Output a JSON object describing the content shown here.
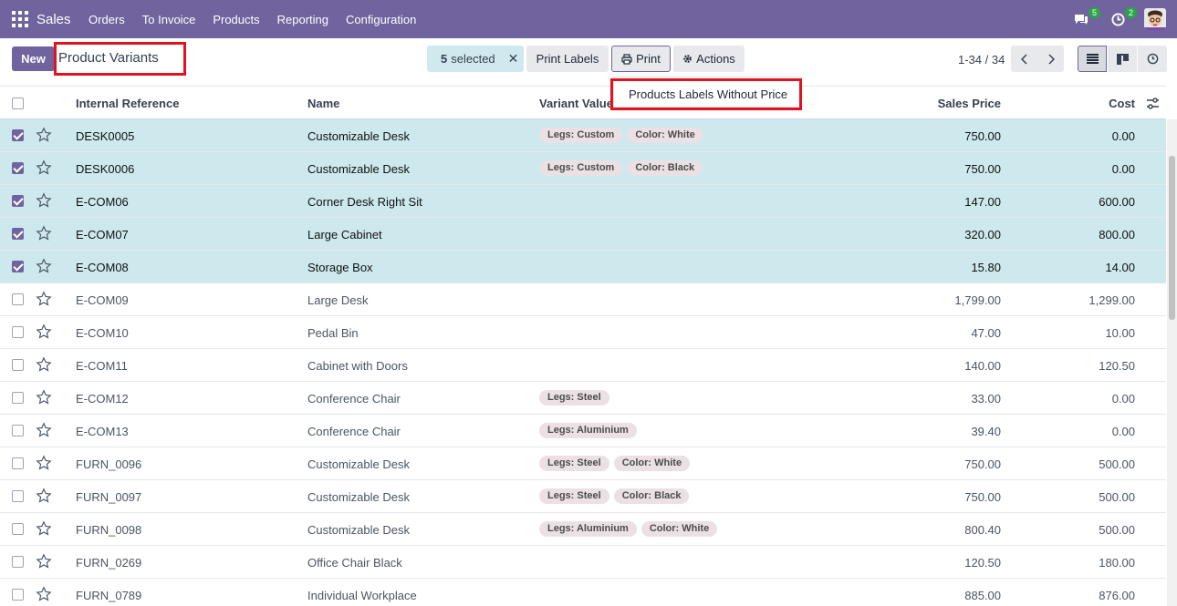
{
  "navbar": {
    "brand": "Sales",
    "menu": [
      "Orders",
      "To Invoice",
      "Products",
      "Reporting",
      "Configuration"
    ],
    "messages_count": "5",
    "activities_count": "2"
  },
  "control_panel": {
    "new_label": "New",
    "title": "Product Variants",
    "selected_count": "5",
    "selected_label": "selected",
    "print_labels": "Print Labels",
    "print": "Print",
    "actions": "Actions",
    "pager": "1-34 / 34"
  },
  "dropdown": {
    "item": "Products Labels Without Price"
  },
  "table": {
    "headers": {
      "ref": "Internal Reference",
      "name": "Name",
      "variant": "Variant Values",
      "price": "Sales Price",
      "cost": "Cost"
    },
    "rows": [
      {
        "selected": true,
        "ref": "DESK0005",
        "name": "Customizable Desk",
        "tags": [
          "Legs: Custom",
          "Color: White"
        ],
        "price": "750.00",
        "cost": "0.00"
      },
      {
        "selected": true,
        "ref": "DESK0006",
        "name": "Customizable Desk",
        "tags": [
          "Legs: Custom",
          "Color: Black"
        ],
        "price": "750.00",
        "cost": "0.00"
      },
      {
        "selected": true,
        "ref": "E-COM06",
        "name": "Corner Desk Right Sit",
        "tags": [],
        "price": "147.00",
        "cost": "600.00"
      },
      {
        "selected": true,
        "ref": "E-COM07",
        "name": "Large Cabinet",
        "tags": [],
        "price": "320.00",
        "cost": "800.00"
      },
      {
        "selected": true,
        "ref": "E-COM08",
        "name": "Storage Box",
        "tags": [],
        "price": "15.80",
        "cost": "14.00"
      },
      {
        "selected": false,
        "ref": "E-COM09",
        "name": "Large Desk",
        "tags": [],
        "price": "1,799.00",
        "cost": "1,299.00"
      },
      {
        "selected": false,
        "ref": "E-COM10",
        "name": "Pedal Bin",
        "tags": [],
        "price": "47.00",
        "cost": "10.00"
      },
      {
        "selected": false,
        "ref": "E-COM11",
        "name": "Cabinet with Doors",
        "tags": [],
        "price": "140.00",
        "cost": "120.50"
      },
      {
        "selected": false,
        "ref": "E-COM12",
        "name": "Conference Chair",
        "tags": [
          "Legs: Steel"
        ],
        "price": "33.00",
        "cost": "0.00"
      },
      {
        "selected": false,
        "ref": "E-COM13",
        "name": "Conference Chair",
        "tags": [
          "Legs: Aluminium"
        ],
        "price": "39.40",
        "cost": "0.00"
      },
      {
        "selected": false,
        "ref": "FURN_0096",
        "name": "Customizable Desk",
        "tags": [
          "Legs: Steel",
          "Color: White"
        ],
        "price": "750.00",
        "cost": "500.00"
      },
      {
        "selected": false,
        "ref": "FURN_0097",
        "name": "Customizable Desk",
        "tags": [
          "Legs: Steel",
          "Color: Black"
        ],
        "price": "750.00",
        "cost": "500.00"
      },
      {
        "selected": false,
        "ref": "FURN_0098",
        "name": "Customizable Desk",
        "tags": [
          "Legs: Aluminium",
          "Color: White"
        ],
        "price": "800.40",
        "cost": "500.00"
      },
      {
        "selected": false,
        "ref": "FURN_0269",
        "name": "Office Chair Black",
        "tags": [],
        "price": "120.50",
        "cost": "180.00"
      },
      {
        "selected": false,
        "ref": "FURN_0789",
        "name": "Individual Workplace",
        "tags": [],
        "price": "885.00",
        "cost": "876.00"
      }
    ]
  },
  "colors": {
    "brand": "#71639e",
    "selected_row": "#cde9ee",
    "highlight_box": "#e0141e"
  }
}
